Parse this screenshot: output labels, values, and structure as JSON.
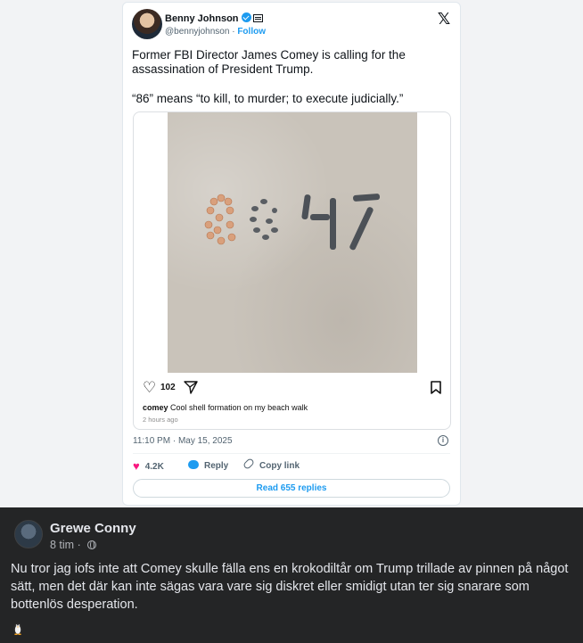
{
  "tweet": {
    "author_name": "Benny Johnson",
    "handle": "@bennyjohnson",
    "separator": " · ",
    "follow_label": "Follow",
    "text_line1": "Former FBI Director James Comey is calling for the assassination of President Trump.",
    "text_line2": "“86” means “to kill, to murder; to execute judicially.”",
    "icons": {
      "verified": "verified-badge-icon",
      "org": "organization-badge-icon",
      "logo": "x-logo-icon",
      "info": "info-icon"
    },
    "timestamp": "11:10 PM · May 15, 2025",
    "likes": "4.2K",
    "reply_label": "Reply",
    "copy_link_label": "Copy link",
    "read_replies_label": "Read 655 replies",
    "colors": {
      "accent": "#1d9bf0",
      "like": "#f91880"
    }
  },
  "instagram_embed": {
    "image_text": "8647",
    "like_count": "102",
    "caption_user": "comey",
    "caption_text": "Cool shell formation on my beach walk",
    "time_ago": "2 hours ago"
  },
  "post": {
    "author_name": "Grewe Conny",
    "time": "8 tim",
    "separator": " · ",
    "body": "Nu tror jag iofs inte att Comey skulle fälla ens en krokodiltår om Trump trillade av pinnen på något sätt, men det där kan inte sägas vara vare sig diskret eller smidigt utan ter sig snarare som bottenlös desperation.",
    "emoji_icon": "penguin-icon"
  }
}
